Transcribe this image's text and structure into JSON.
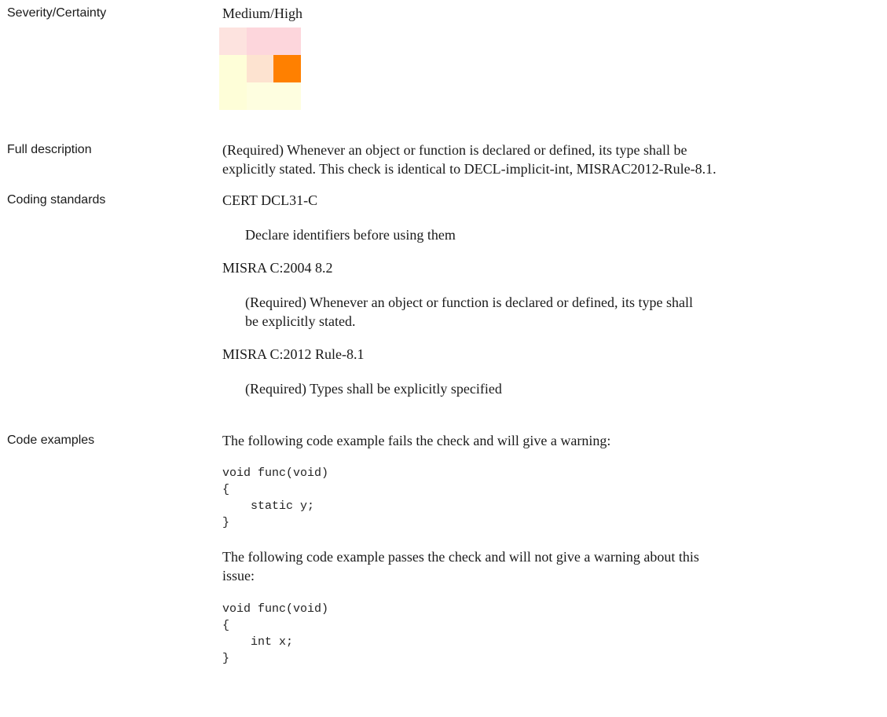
{
  "severity": {
    "label": "Severity/Certainty",
    "value": "Medium/High",
    "matrix_colors": [
      [
        "#fde3df",
        "#fdd6dc",
        "#fdd6dc"
      ],
      [
        "#fefed8",
        "#fde3d0",
        "#ff8000"
      ],
      [
        "#fefed8",
        "#fefee0",
        "#fefee0"
      ]
    ]
  },
  "full_description": {
    "label": "Full description",
    "line1": " (Required) Whenever an object or function is declared or defined, its type shall be",
    "line2": "explicitly stated. This check is identical to DECL-implicit-int, MISRAC2012-Rule-8.1."
  },
  "coding_standards": {
    "label": "Coding standards",
    "items": [
      {
        "name": "CERT DCL31-C",
        "desc_line1": "Declare identifiers before using them",
        "desc_line2": ""
      },
      {
        "name": "MISRA C:2004 8.2",
        "desc_line1": "(Required) Whenever an object or function is declared or defined, its type shall",
        "desc_line2": "be explicitly stated."
      },
      {
        "name": "MISRA C:2012 Rule-8.1",
        "desc_line1": "(Required) Types shall be explicitly specified",
        "desc_line2": ""
      }
    ]
  },
  "code_examples": {
    "label": "Code examples",
    "fail_intro": "The following code example fails the check and will give a warning:",
    "fail_code": "void func(void)\n{\n    static y;\n}",
    "pass_intro_line1": "The following code example passes the check and will not give a warning about this",
    "pass_intro_line2": "issue:",
    "pass_code": "void func(void)\n{\n    int x;\n}"
  }
}
